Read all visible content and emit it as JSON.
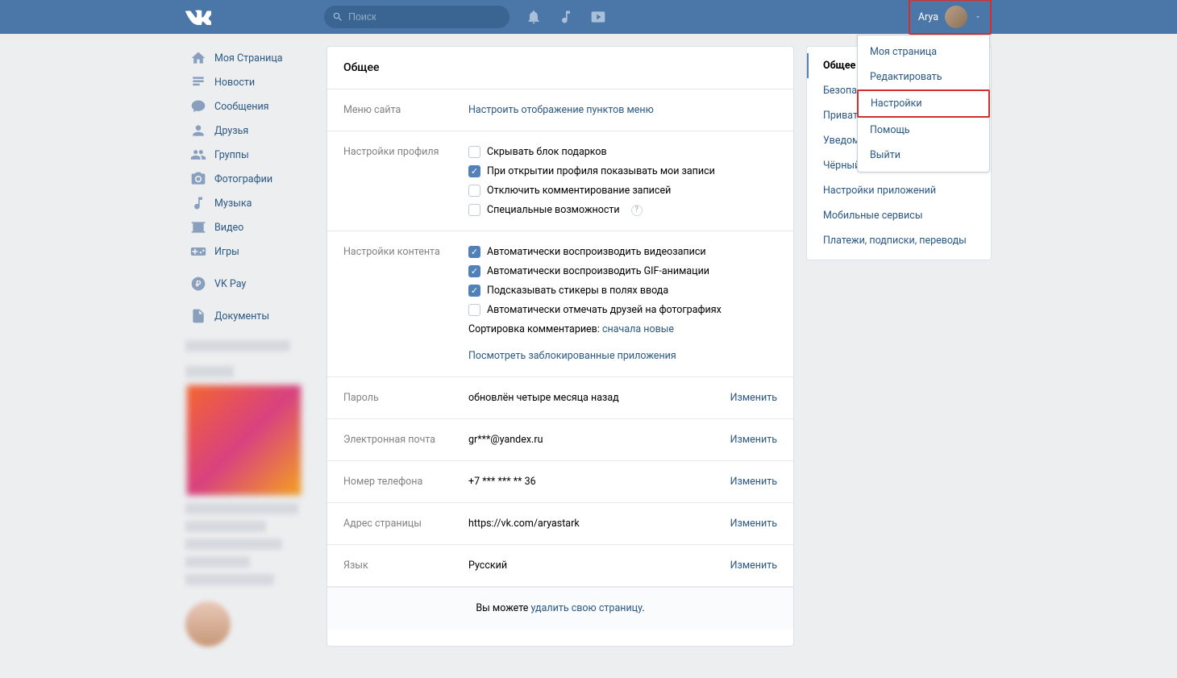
{
  "header": {
    "search_placeholder": "Поиск",
    "username": "Arya"
  },
  "dropdown": {
    "items": [
      {
        "label": "Моя страница"
      },
      {
        "label": "Редактировать"
      },
      {
        "label": "Настройки",
        "highlighted": true
      },
      {
        "label": "Помощь"
      },
      {
        "label": "Выйти"
      }
    ]
  },
  "sidebar": {
    "items": [
      {
        "label": "Моя Страница",
        "icon": "home"
      },
      {
        "label": "Новости",
        "icon": "news"
      },
      {
        "label": "Сообщения",
        "icon": "message"
      },
      {
        "label": "Друзья",
        "icon": "friends"
      },
      {
        "label": "Группы",
        "icon": "groups"
      },
      {
        "label": "Фотографии",
        "icon": "photo"
      },
      {
        "label": "Музыка",
        "icon": "music"
      },
      {
        "label": "Видео",
        "icon": "video"
      },
      {
        "label": "Игры",
        "icon": "games"
      }
    ],
    "vkpay": "VK Pay",
    "documents": "Документы"
  },
  "settings": {
    "title": "Общее",
    "menu_site": {
      "label": "Меню сайта",
      "link": "Настроить отображение пунктов меню"
    },
    "profile": {
      "label": "Настройки профиля",
      "opts": [
        {
          "label": "Скрывать блок подарков",
          "checked": false
        },
        {
          "label": "При открытии профиля показывать мои записи",
          "checked": true
        },
        {
          "label": "Отключить комментирование записей",
          "checked": false
        },
        {
          "label": "Специальные возможности",
          "checked": false,
          "help": true
        }
      ]
    },
    "content": {
      "label": "Настройки контента",
      "opts": [
        {
          "label": "Автоматически воспроизводить видеозаписи",
          "checked": true
        },
        {
          "label": "Автоматически воспроизводить GIF-анимации",
          "checked": true
        },
        {
          "label": "Подсказывать стикеры в полях ввода",
          "checked": true
        },
        {
          "label": "Автоматически отмечать друзей на фотографиях",
          "checked": false
        }
      ],
      "sort_label": "Сортировка комментариев: ",
      "sort_value": "сначала новые",
      "blocked_apps": "Посмотреть заблокированные приложения"
    },
    "password": {
      "label": "Пароль",
      "value": "обновлён четыре месяца назад",
      "action": "Изменить"
    },
    "email": {
      "label": "Электронная почта",
      "value": "gr***@yandex.ru",
      "action": "Изменить"
    },
    "phone": {
      "label": "Номер телефона",
      "value": "+7 *** *** ** 36",
      "action": "Изменить"
    },
    "url": {
      "label": "Адрес страницы",
      "value": "https://vk.com/aryastark",
      "action": "Изменить"
    },
    "lang": {
      "label": "Язык",
      "value": "Русский",
      "action": "Изменить"
    },
    "footer": {
      "prefix": "Вы можете ",
      "link": "удалить свою страницу",
      "suffix": "."
    }
  },
  "tabs": [
    {
      "label": "Общее",
      "active": true
    },
    {
      "label": "Безопасность"
    },
    {
      "label": "Приватность"
    },
    {
      "label": "Уведомления"
    },
    {
      "label": "Чёрный список"
    },
    {
      "label": "Настройки приложений"
    },
    {
      "label": "Мобильные сервисы"
    },
    {
      "label": "Платежи, подписки, переводы"
    }
  ]
}
